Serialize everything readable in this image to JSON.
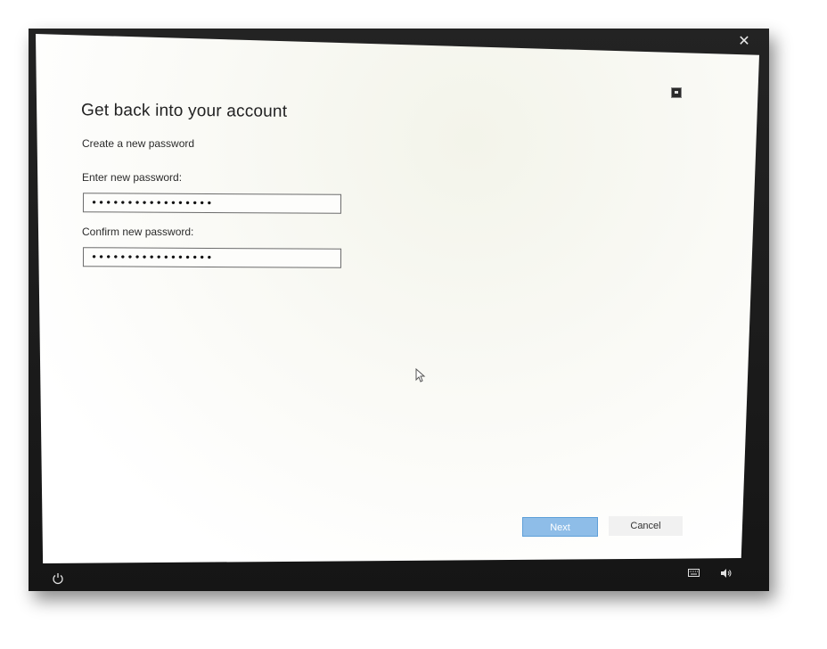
{
  "window": {
    "close_glyph": "✕"
  },
  "header": {
    "title": "Get back into your account",
    "subtitle": "Create a new password"
  },
  "form": {
    "new_password": {
      "label": "Enter new password:",
      "value": "•••••••••••••••••"
    },
    "confirm_password": {
      "label": "Confirm new password:",
      "value": "•••••••••••••••••"
    }
  },
  "buttons": {
    "next_label": "Next",
    "cancel_label": "Cancel"
  },
  "taskbar": {
    "ease_of_access_icon": "power-icon",
    "keyboard_icon": "keyboard-icon",
    "volume_icon": "volume-icon"
  },
  "colors": {
    "accent": "#8ebde8",
    "background": "#ffffff",
    "bezel": "#1b1b1b"
  }
}
